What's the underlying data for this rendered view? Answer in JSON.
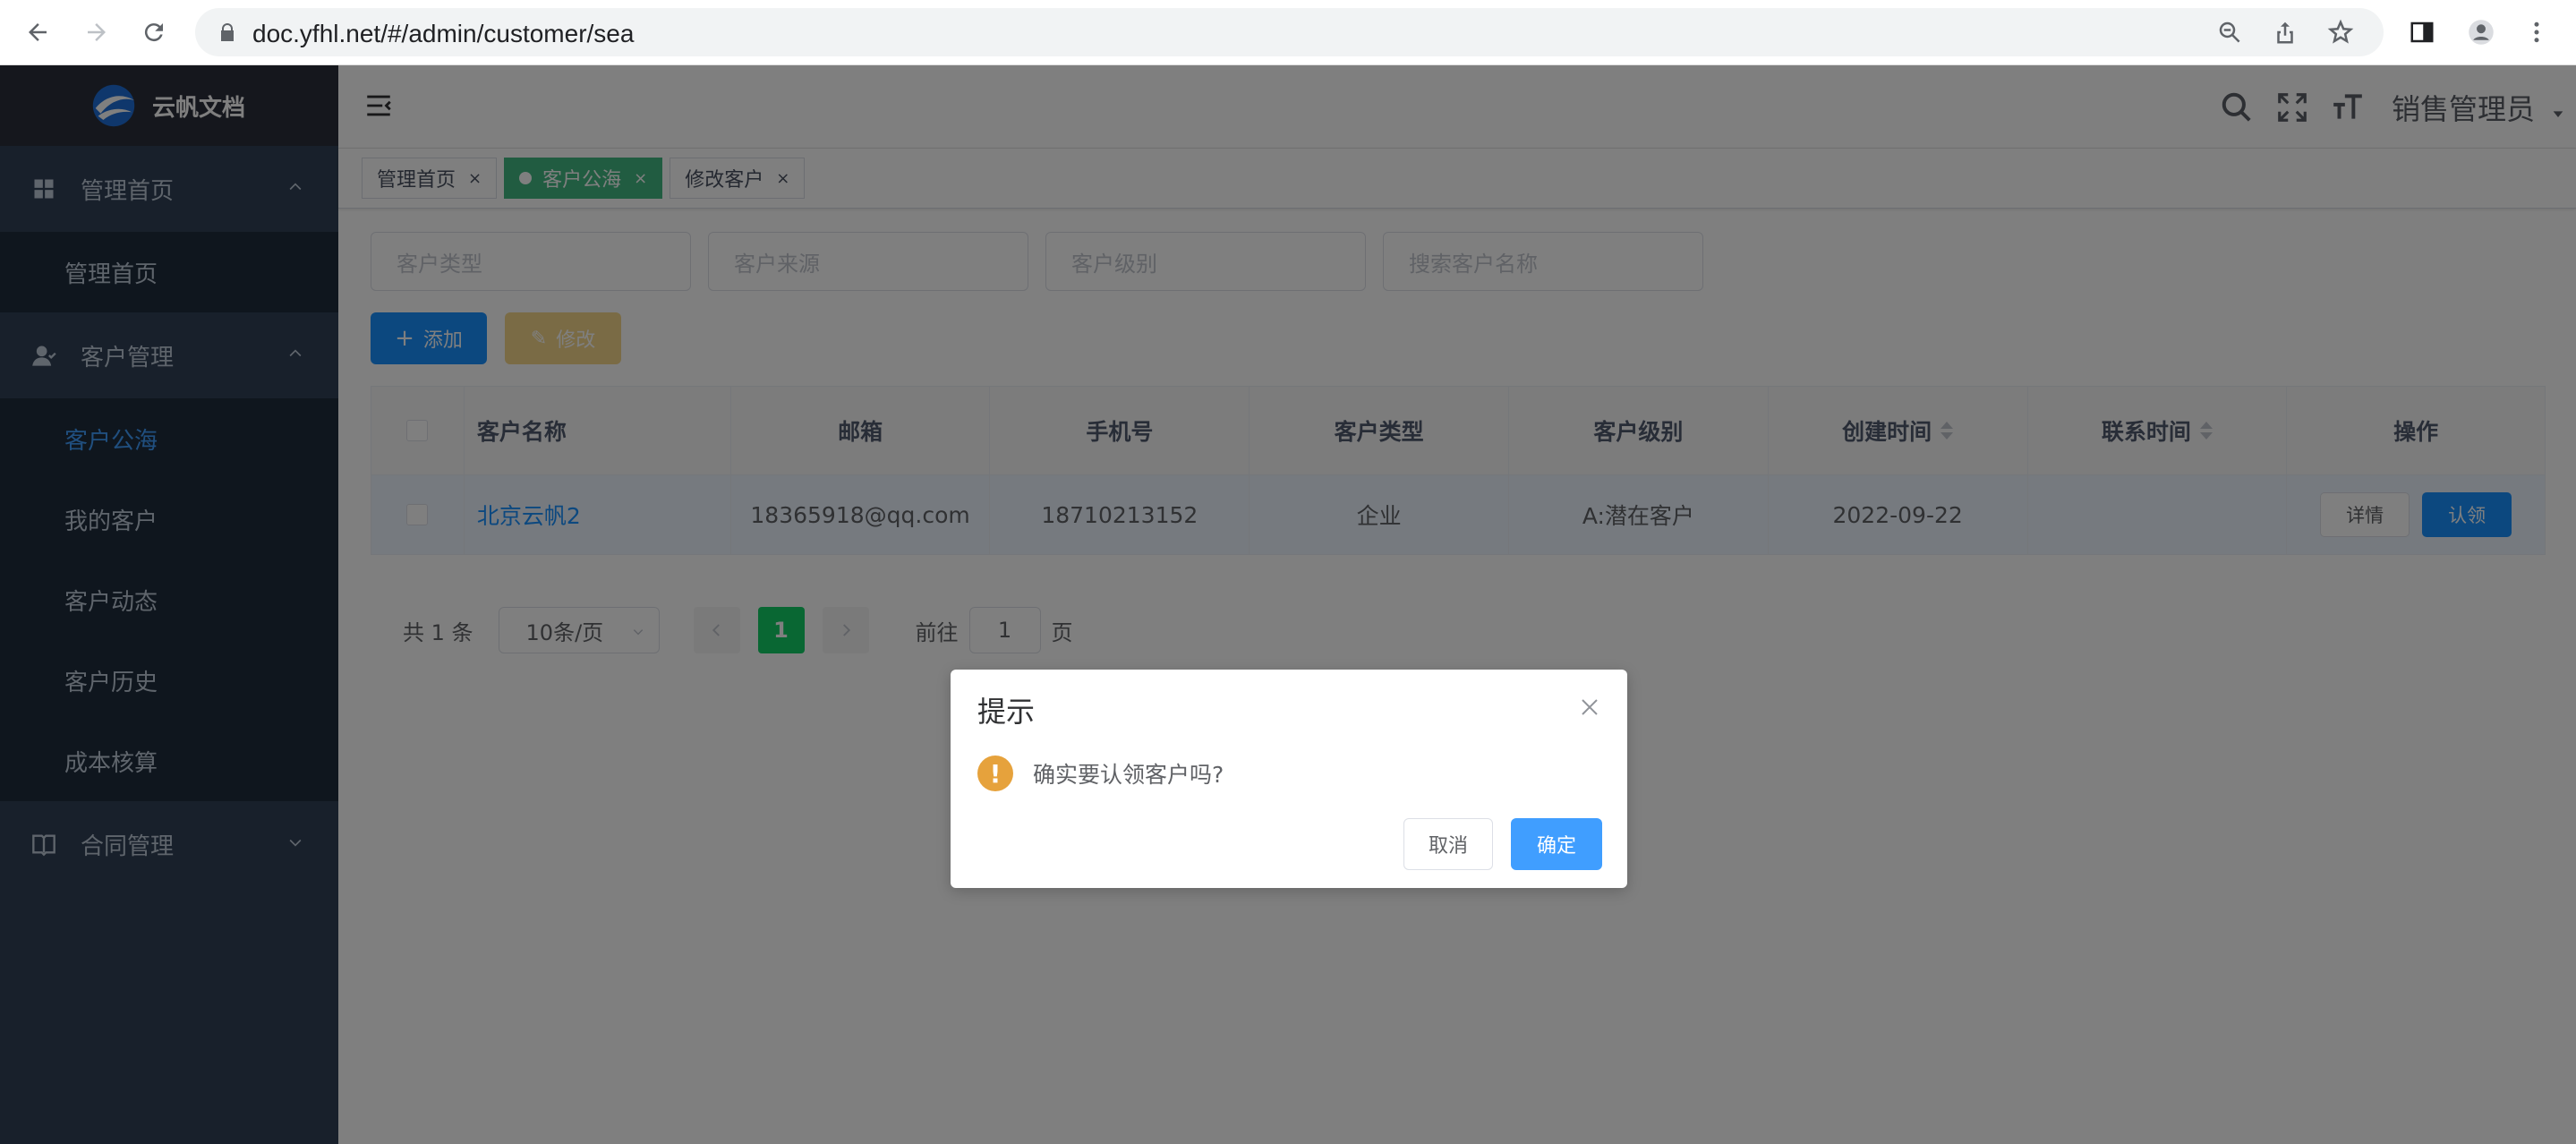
{
  "browser": {
    "url": "doc.yfhl.net/#/admin/customer/sea"
  },
  "sidebar": {
    "logo_text": "云帆文档",
    "groups": [
      {
        "label": "管理首页",
        "items": [
          {
            "label": "管理首页"
          }
        ]
      },
      {
        "label": "客户管理",
        "items": [
          {
            "label": "客户公海",
            "active": true
          },
          {
            "label": "我的客户"
          },
          {
            "label": "客户动态"
          },
          {
            "label": "客户历史"
          },
          {
            "label": "成本核算"
          }
        ]
      },
      {
        "label": "合同管理",
        "items": []
      }
    ]
  },
  "navbar": {
    "user_name": "销售管理员"
  },
  "tags": [
    {
      "label": "管理首页"
    },
    {
      "label": "客户公海",
      "active": true
    },
    {
      "label": "修改客户"
    }
  ],
  "filters": {
    "customer_type_placeholder": "客户类型",
    "customer_source_placeholder": "客户来源",
    "customer_level_placeholder": "客户级别",
    "search_name_placeholder": "搜索客户名称"
  },
  "toolbar": {
    "add_label": "添加",
    "edit_label": "修改"
  },
  "table": {
    "headers": [
      "客户名称",
      "邮箱",
      "手机号",
      "客户类型",
      "客户级别",
      "创建时间",
      "联系时间",
      "操作"
    ],
    "rows": [
      {
        "name": "北京云帆2",
        "email": "18365918@qq.com",
        "phone": "18710213152",
        "type": "企业",
        "level": "A:潜在客户",
        "created": "2022-09-22",
        "contacted": "",
        "detail_label": "详情",
        "claim_label": "认领"
      }
    ]
  },
  "pagination": {
    "total_text": "共 1 条",
    "page_size": "10条/页",
    "current_page": "1",
    "goto_prefix": "前往",
    "goto_value": "1",
    "goto_suffix": "页"
  },
  "dialog": {
    "title": "提示",
    "message": "确实要认领客户吗?",
    "cancel_label": "取消",
    "confirm_label": "确定"
  },
  "colors": {
    "sidebar_bg": "#304156",
    "accent": "#1890ff",
    "active_tag": "#42b983",
    "warning": "#e6a23c"
  }
}
